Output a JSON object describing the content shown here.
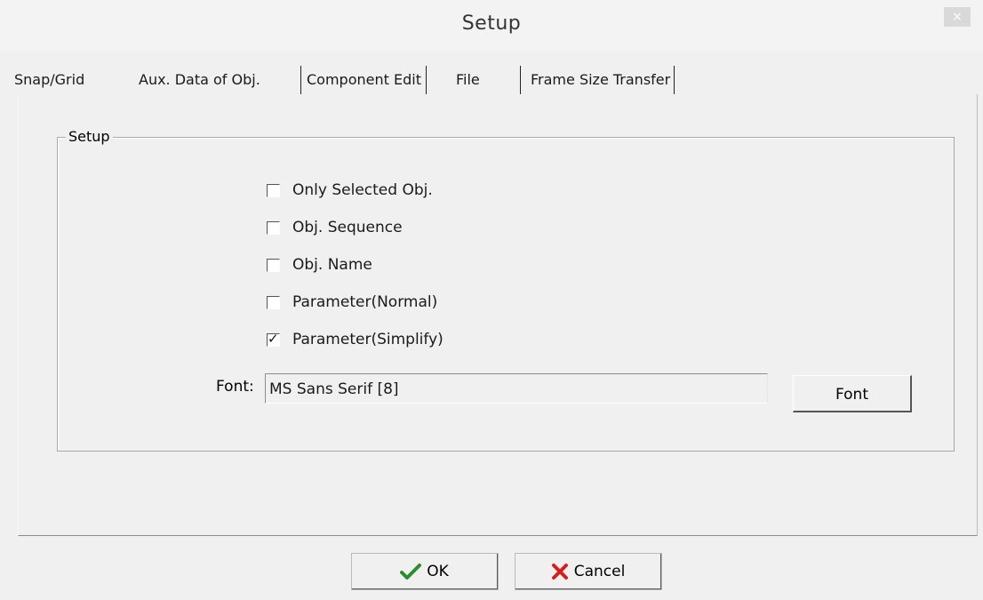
{
  "dialog": {
    "title": "Setup",
    "close_symbol": "×"
  },
  "tabs": [
    {
      "label": "Snap/Grid"
    },
    {
      "label": "Aux. Data of Obj.",
      "selected": true
    },
    {
      "label": "Component Edit"
    },
    {
      "label": "File"
    },
    {
      "label": "Frame Size Transfer"
    }
  ],
  "group": {
    "label": "Setup",
    "options": [
      {
        "label": "Only Selected Obj.",
        "checked": false
      },
      {
        "label": "Obj. Sequence",
        "checked": false
      },
      {
        "label": "Obj. Name",
        "checked": false
      },
      {
        "label": "Parameter(Normal)",
        "checked": false
      },
      {
        "label": "Parameter(Simplify)",
        "checked": true
      }
    ],
    "font_label": "Font:",
    "font_value": "MS Sans Serif [8]",
    "font_button": "Font"
  },
  "buttons": {
    "ok": "OK",
    "cancel": "Cancel"
  },
  "icons": {
    "ok": "checkmark-icon",
    "cancel": "x-mark-icon"
  },
  "colors": {
    "ok_icon": "#2e8b2e",
    "cancel_icon": "#d22020"
  }
}
